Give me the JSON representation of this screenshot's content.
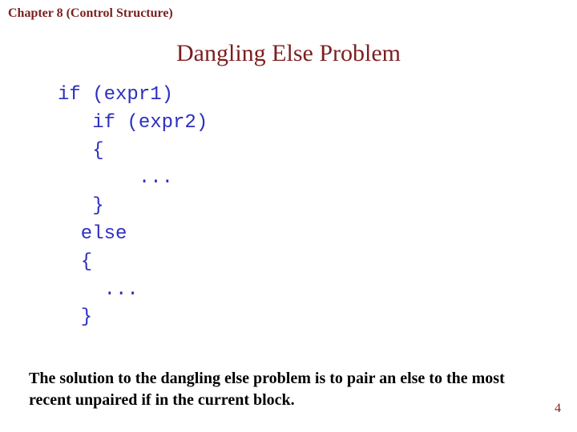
{
  "header": "Chapter 8 (Control Structure)",
  "title": "Dangling Else Problem",
  "code": "if (expr1)\n   if (expr2)\n   {\n       ...\n   }\n  else\n  {\n    ...\n  }",
  "conclusion": "The solution to the dangling else problem is to pair an else to the most recent unpaired if in the current block.",
  "page_number": "4"
}
